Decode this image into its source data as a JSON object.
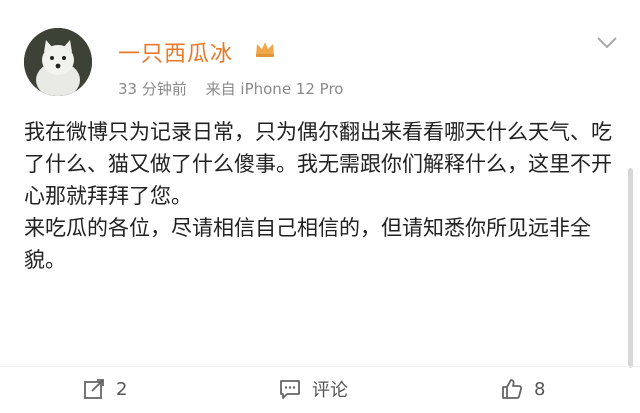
{
  "post": {
    "username": "一只西瓜冰",
    "time": "33 分钟前",
    "source": "来自 iPhone 12 Pro",
    "paragraphs": [
      "我在微博只为记录日常，只为偶尔翻出来看看哪天什么天气、吃了什么、猫又做了什么傻事。我无需跟你们解释什么，这里不开心那就拜拜了您。",
      "来吃瓜的各位，尽请相信自己相信的，但请知悉你所见远非全貌。"
    ]
  },
  "actions": {
    "repost_count": "2",
    "comment_label": "评论",
    "like_count": "8"
  },
  "icons": {
    "avatar": "white-dog-avatar",
    "vip": "crown-vip-icon",
    "more": "chevron-down-icon",
    "repost": "repost-icon",
    "comment": "comment-icon",
    "like": "thumbs-up-icon"
  },
  "colors": {
    "username": "#e8792a",
    "meta": "#8a8a8a",
    "vip": "#f0a94a"
  }
}
